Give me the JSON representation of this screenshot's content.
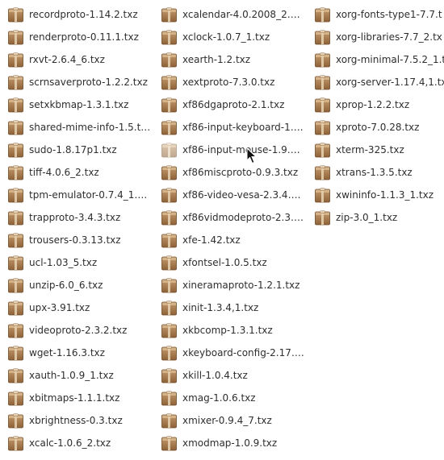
{
  "files": {
    "column1": [
      {
        "name": "recordproto-1.14.2.txz"
      },
      {
        "name": "renderproto-0.11.1.txz"
      },
      {
        "name": "rxvt-2.6.4_6.txz"
      },
      {
        "name": "scrnsaverproto-1.2.2.txz"
      },
      {
        "name": "setxkbmap-1.3.1.txz"
      },
      {
        "name": "shared-mime-info-1.5.t…"
      },
      {
        "name": "sudo-1.8.17p1.txz"
      },
      {
        "name": "tiff-4.0.6_2.txz"
      },
      {
        "name": "tpm-emulator-0.7.4_1…."
      },
      {
        "name": "trapproto-3.4.3.txz"
      },
      {
        "name": "trousers-0.3.13.txz"
      },
      {
        "name": "ucl-1.03_5.txz"
      },
      {
        "name": "unzip-6.0_6.txz"
      },
      {
        "name": "upx-3.91.txz"
      },
      {
        "name": "videoproto-2.3.2.txz"
      },
      {
        "name": "wget-1.16.3.txz"
      },
      {
        "name": "xauth-1.0.9_1.txz"
      },
      {
        "name": "xbitmaps-1.1.1.txz"
      },
      {
        "name": "xbrightness-0.3.txz"
      },
      {
        "name": "xcalc-1.0.6_2.txz"
      }
    ],
    "column2": [
      {
        "name": "xcalendar-4.0.2008_2…."
      },
      {
        "name": "xclock-1.0.7_1.txz"
      },
      {
        "name": "xearth-1.2.txz"
      },
      {
        "name": "xextproto-7.3.0.txz"
      },
      {
        "name": "xf86dgaproto-2.1.txz"
      },
      {
        "name": "xf86-input-keyboard-1…."
      },
      {
        "name": "xf86-input-mouse-1.9…."
      },
      {
        "name": "xf86miscproto-0.9.3.txz"
      },
      {
        "name": "xf86-video-vesa-2.3.4…."
      },
      {
        "name": "xf86vidmodeproto-2.3…."
      },
      {
        "name": "xfe-1.42.txz"
      },
      {
        "name": "xfontsel-1.0.5.txz"
      },
      {
        "name": "xineramaproto-1.2.1.txz"
      },
      {
        "name": "xinit-1.3.4,1.txz"
      },
      {
        "name": "xkbcomp-1.3.1.txz"
      },
      {
        "name": "xkeyboard-config-2.17…."
      },
      {
        "name": "xkill-1.0.4.txz"
      },
      {
        "name": "xmag-1.0.6.txz"
      },
      {
        "name": "xmixer-0.9.4_7.txz"
      },
      {
        "name": "xmodmap-1.0.9.txz"
      }
    ],
    "column3": [
      {
        "name": "xorg-fonts-type1-7.7.t"
      },
      {
        "name": "xorg-libraries-7.7_2.tx"
      },
      {
        "name": "xorg-minimal-7.5.2_1.t"
      },
      {
        "name": "xorg-server-1.17.4,1.tx"
      },
      {
        "name": "xprop-1.2.2.txz"
      },
      {
        "name": "xproto-7.0.28.txz"
      },
      {
        "name": "xterm-325.txz"
      },
      {
        "name": "xtrans-1.3.5.txz"
      },
      {
        "name": "xwininfo-1.1.3_1.txz"
      },
      {
        "name": "zip-3.0_1.txz"
      }
    ]
  },
  "selected_file": "xf86-input-mouse-1.9….",
  "icon": "package-archive-icon",
  "colors": {
    "icon_body": "#a57a4e",
    "icon_light": "#d8b88f",
    "text": "#2e2e2e",
    "background": "#ffffff"
  }
}
